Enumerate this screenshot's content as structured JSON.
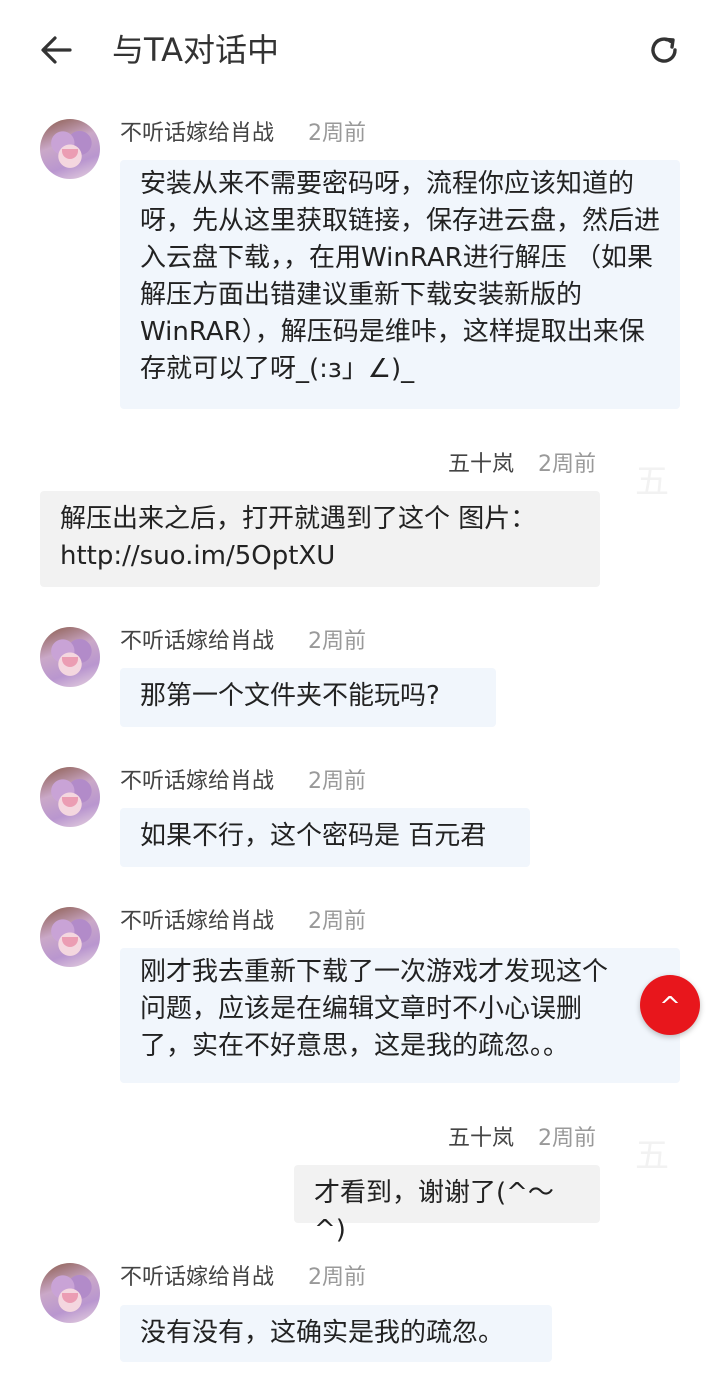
{
  "header": {
    "title": "与TA对话中",
    "back_icon": "arrow-left-icon",
    "refresh_icon": "refresh-icon"
  },
  "messages": [
    {
      "sender": "不听话嫁给肖战",
      "time": "2周前",
      "text": "安装从来不需要密码呀，流程你应该知道的呀，先从这里获取链接，保存进云盘，然后进入云盘下载，，在用WinRAR进行解压 （如果解压方面出错建议重新下载安装新版的WinRAR），解压码是维咔，这样提取出来保存就可以了呀_(:з」∠)_"
    },
    {
      "sender": "五十岚",
      "time": "2周前",
      "avatar_text": "五",
      "text": "解压出来之后，打开就遇到了这个 图片：http://suo.im/5OptXU"
    },
    {
      "sender": "不听话嫁给肖战",
      "time": "2周前",
      "text": "那第一个文件夹不能玩吗?"
    },
    {
      "sender": "不听话嫁给肖战",
      "time": "2周前",
      "text": "如果不行，这个密码是 百元君"
    },
    {
      "sender": "不听话嫁给肖战",
      "time": "2周前",
      "text": "刚才我去重新下载了一次游戏才发现这个问题，应该是在编辑文章时不小心误删了，实在不好意思，这是我的疏忽。。"
    },
    {
      "sender": "五十岚",
      "time": "2周前",
      "avatar_text": "五",
      "text": "才看到，谢谢了(^～^)"
    },
    {
      "sender": "不听话嫁给肖战",
      "time": "2周前",
      "text": "没有没有，这确实是我的疏忽。"
    }
  ],
  "scroll_top": {
    "label": "^",
    "color": "#e8161c"
  },
  "colors": {
    "incoming_bubble": "#f1f6fc",
    "outgoing_bubble": "#f2f2f2",
    "time_text": "#999999"
  }
}
